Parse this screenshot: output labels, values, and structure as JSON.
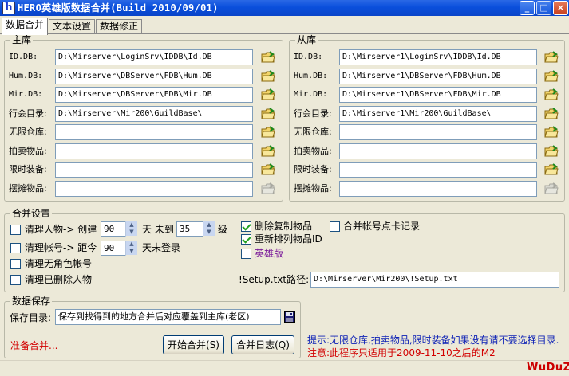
{
  "window": {
    "title": "HERO英雄版数据合并(Build 2010/09/01)",
    "app_icon": "h",
    "min_label": "_",
    "max_label": "□",
    "close_label": "×"
  },
  "tabs": [
    {
      "label": "数据合并"
    },
    {
      "label": "文本设置"
    },
    {
      "label": "数据修正"
    }
  ],
  "master": {
    "title": "主库",
    "rows": [
      {
        "label": "ID.DB:",
        "value": "D:\\Mirserver\\LoginSrv\\IDDB\\Id.DB"
      },
      {
        "label": "Hum.DB:",
        "value": "D:\\Mirserver\\DBServer\\FDB\\Hum.DB"
      },
      {
        "label": "Mir.DB:",
        "value": "D:\\Mirserver\\DBServer\\FDB\\Mir.DB"
      },
      {
        "label": "行会目录:",
        "value": "D:\\Mirserver\\Mir200\\GuildBase\\"
      },
      {
        "label": "无限仓库:",
        "value": ""
      },
      {
        "label": "拍卖物品:",
        "value": ""
      },
      {
        "label": "限时装备:",
        "value": ""
      },
      {
        "label": "摆摊物品:",
        "value": ""
      }
    ]
  },
  "slave": {
    "title": "从库",
    "rows": [
      {
        "label": "ID.DB:",
        "value": "D:\\Mirserver1\\LoginSrv\\IDDB\\Id.DB"
      },
      {
        "label": "Hum.DB:",
        "value": "D:\\Mirserver1\\DBServer\\FDB\\Hum.DB"
      },
      {
        "label": "Mir.DB:",
        "value": "D:\\Mirserver1\\DBServer\\FDB\\Mir.DB"
      },
      {
        "label": "行会目录:",
        "value": "D:\\Mirserver1\\Mir200\\GuildBase\\"
      },
      {
        "label": "无限仓库:",
        "value": ""
      },
      {
        "label": "拍卖物品:",
        "value": ""
      },
      {
        "label": "限时装备:",
        "value": ""
      },
      {
        "label": "摆摊物品:",
        "value": ""
      }
    ]
  },
  "merge_settings": {
    "title": "合并设置",
    "clean_char_label": "清理人物-> 创建",
    "clean_char_value": "90",
    "clean_char_unit1": "天 未到",
    "clean_char_level": "35",
    "clean_char_unit2": "级",
    "clean_account_label": "清理帐号-> 距今",
    "clean_account_value": "90",
    "clean_account_unit": "天未登录",
    "clean_no_char_label": "清理无角色帐号",
    "clean_deleted_label": "清理已删除人物",
    "delete_copy_items_label": "删除复制物品",
    "reorder_item_id_label": "重新排列物品ID",
    "hero_edition_label": "英雄版",
    "merge_account_card_label": "合并帐号点卡记录",
    "setup_path_label": "!Setup.txt路径:",
    "setup_path_value": "D:\\Mirserver\\Mir200\\!Setup.txt",
    "colors": {
      "hero": "#7a1a9a",
      "check": "#21a121"
    }
  },
  "data_save": {
    "title": "数据保存",
    "save_dir_label": "保存目录:",
    "save_dir_value": "保存到找得到的地方合并后对应覆盖到主库(老区)",
    "status": "准备合并...",
    "start_button": "开始合并(S)",
    "log_button": "合并日志(Q)"
  },
  "hints": {
    "hint1": "提示:无限仓库,拍卖物品,限时装备如果没有请不要选择目录.",
    "hint2": "注意:此程序只适用于2009-11-10之后的M2",
    "colors": {
      "hint1": "#0b1fb5",
      "hint2": "#d20000"
    }
  },
  "logo": {
    "text": "WuDuZ"
  }
}
